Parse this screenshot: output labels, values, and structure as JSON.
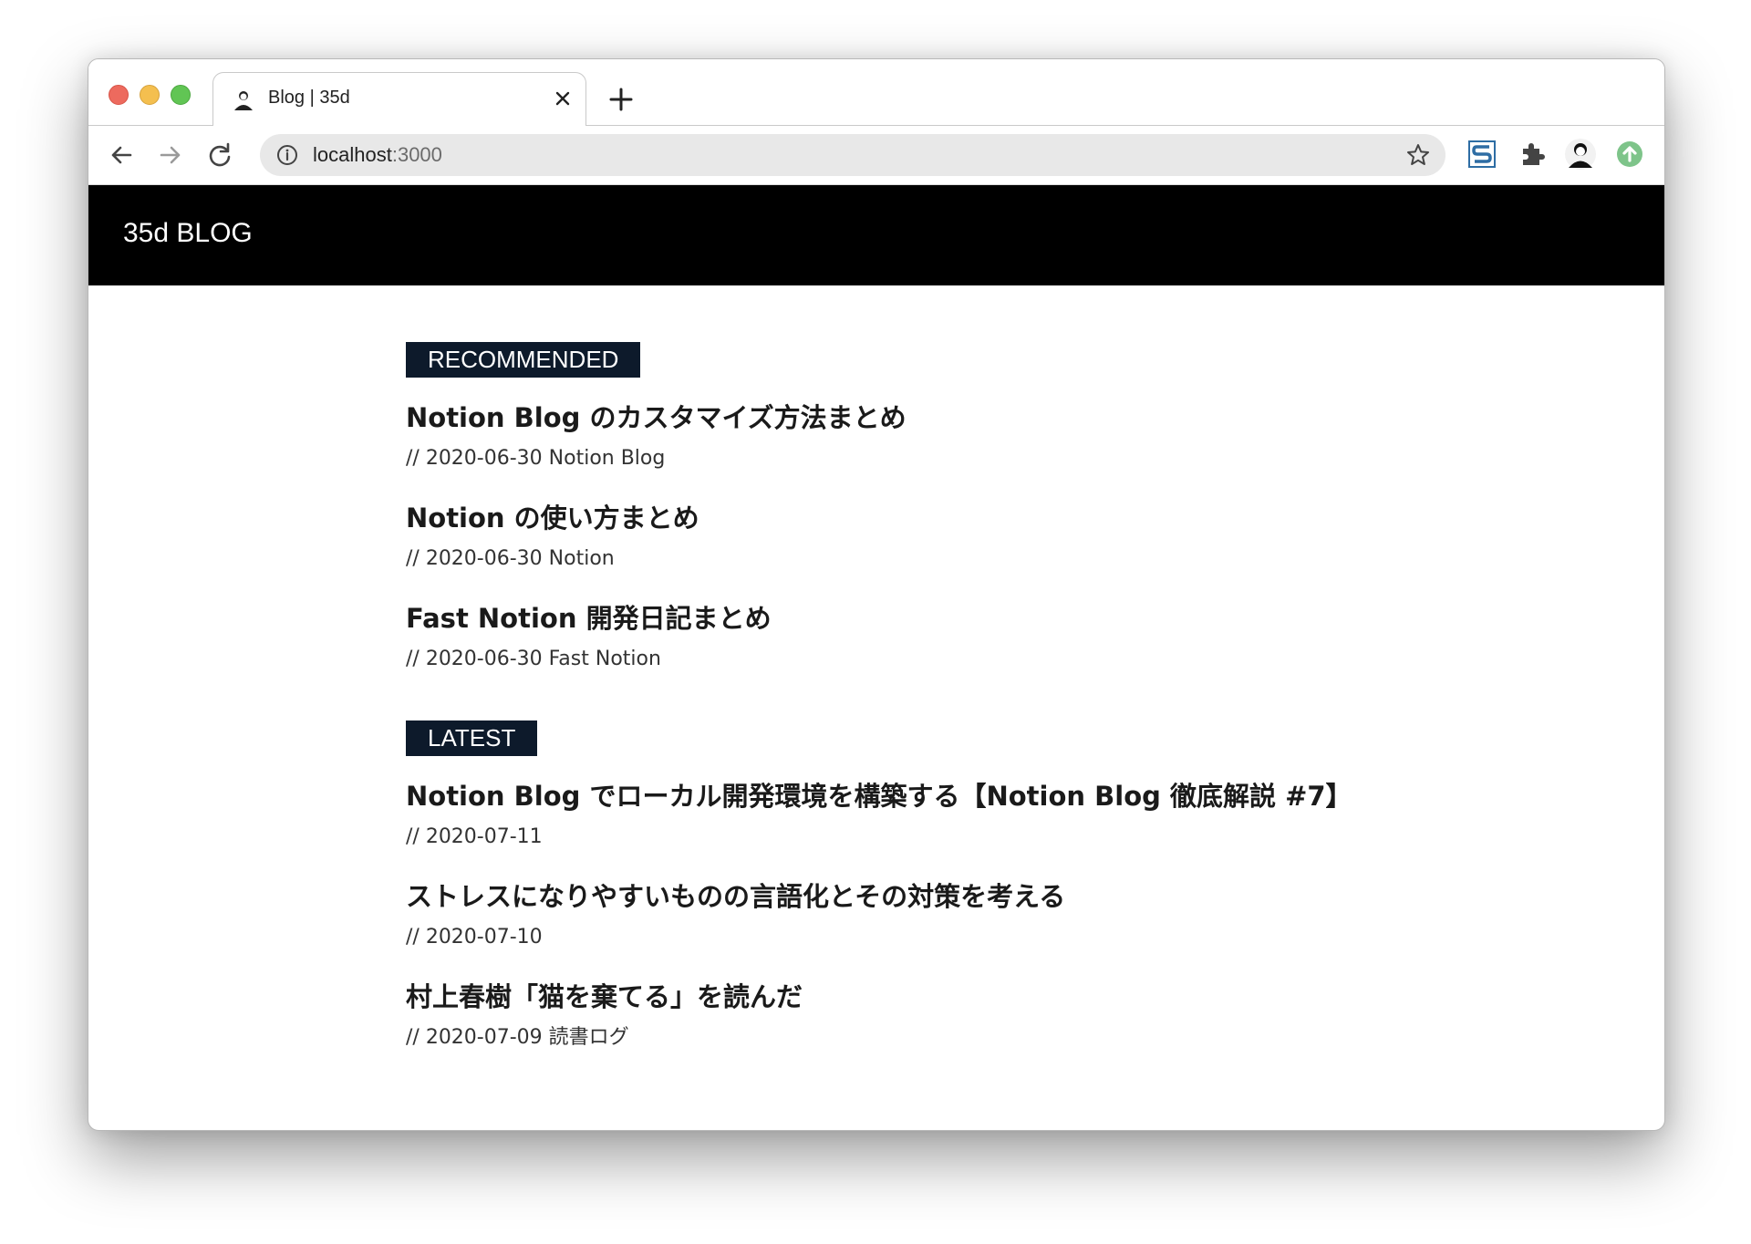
{
  "browser": {
    "tab_title": "Blog | 35d",
    "url_host": "localhost",
    "url_port": ":3000",
    "icons": {
      "back": "arrow-left-icon",
      "forward": "arrow-right-icon",
      "reload": "reload-icon",
      "info": "info-icon",
      "bookmark": "star-icon",
      "extensions": [
        "s-extension-icon",
        "puzzle-icon",
        "avatar-icon",
        "upload-icon"
      ]
    }
  },
  "site": {
    "title": "35d BLOG"
  },
  "sections": {
    "recommended": {
      "label": "RECOMMENDED",
      "posts": [
        {
          "title": "Notion Blog のカスタマイズ方法まとめ",
          "meta": "// 2020-06-30 Notion Blog"
        },
        {
          "title": "Notion の使い方まとめ",
          "meta": "// 2020-06-30 Notion"
        },
        {
          "title": "Fast Notion 開発日記まとめ",
          "meta": "// 2020-06-30 Fast Notion"
        }
      ]
    },
    "latest": {
      "label": "LATEST",
      "posts": [
        {
          "title": "Notion Blog でローカル開発環境を構築する【Notion Blog 徹底解説 #7】",
          "meta": "// 2020-07-11"
        },
        {
          "title": "ストレスになりやすいものの言語化とその対策を考える",
          "meta": "// 2020-07-10"
        },
        {
          "title": "村上春樹「猫を棄てる」を読んだ",
          "meta": "// 2020-07-09 読書ログ"
        }
      ]
    }
  },
  "colors": {
    "header_bg": "#000000",
    "label_bg": "#0d1a2b",
    "traffic_close": "#ed6a5e",
    "traffic_min": "#f4bf4f",
    "traffic_max": "#61c554"
  }
}
